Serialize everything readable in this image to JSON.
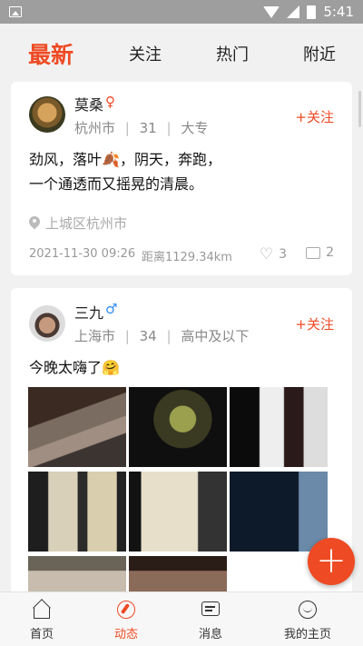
{
  "status_bar": {
    "time": "5:41"
  },
  "top_tabs": [
    {
      "label": "最新",
      "active": true
    },
    {
      "label": "关注",
      "active": false
    },
    {
      "label": "热门",
      "active": false
    },
    {
      "label": "附近",
      "active": false
    }
  ],
  "posts": [
    {
      "username": "莫桑",
      "gender_symbol": "♀",
      "gender_color": "#ee4a23",
      "city": "杭州市",
      "age": "31",
      "education": "大专",
      "follow_label": "+关注",
      "text_line1": "劲风，落叶",
      "text_line1b": "，阴天，奔跑，",
      "text_line2": "一个通透而又摇晃的清晨。",
      "leaf_emoji": "🍂",
      "location": "上城区杭州市",
      "timestamp": "2021-11-30 09:26",
      "distance": "距离1129.34km",
      "likes": "3",
      "comments": "2"
    },
    {
      "username": "三九",
      "gender_symbol": "♂",
      "gender_color": "#2f8ef3",
      "city": "上海市",
      "age": "34",
      "education": "高中及以下",
      "follow_label": "+关注",
      "text": "今晚太嗨了",
      "emoji": "🤗"
    }
  ],
  "info_separator": "|",
  "fab_label": "+",
  "bottom_nav": [
    {
      "label": "首页",
      "icon": "home-icon",
      "active": false
    },
    {
      "label": "动态",
      "icon": "compass-icon",
      "active": true
    },
    {
      "label": "消息",
      "icon": "message-icon",
      "active": false
    },
    {
      "label": "我的主页",
      "icon": "profile-icon",
      "active": false
    }
  ],
  "colors": {
    "accent": "#ee4a23",
    "male": "#2f8ef3"
  }
}
